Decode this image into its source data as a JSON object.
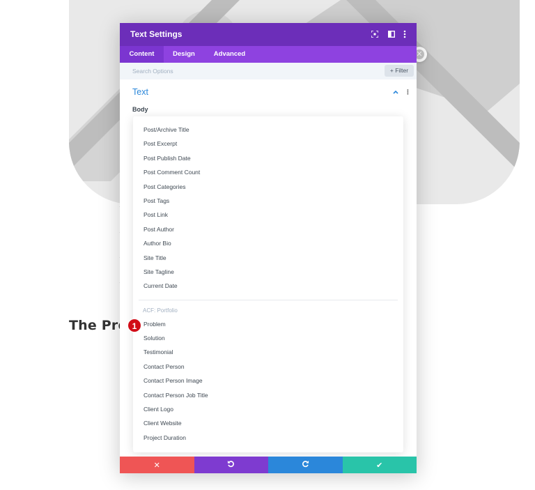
{
  "modal": {
    "title": "Text Settings",
    "tabs": [
      "Content",
      "Design",
      "Advanced"
    ],
    "active_tab": "Content",
    "search_placeholder": "Search Options",
    "filter_label": "+ Filter",
    "section_title": "Text",
    "field_label": "Body"
  },
  "dropdown": {
    "post_items": [
      "Post/Archive Title",
      "Post Excerpt",
      "Post Publish Date",
      "Post Comment Count",
      "Post Categories",
      "Post Tags",
      "Post Link",
      "Post Author",
      "Author Bio",
      "Site Title",
      "Site Tagline",
      "Current Date"
    ],
    "group_label": "ACF: Portfolio",
    "acf_items": [
      "Problem",
      "Solution",
      "Testimonial",
      "Contact Person",
      "Contact Person Image",
      "Contact Person Job Title",
      "Client Logo",
      "Client Website",
      "Project Duration"
    ]
  },
  "background": {
    "heading": "The Pro"
  },
  "annotation": {
    "marker": "1"
  },
  "footer": {
    "icons": [
      "close-icon",
      "undo-icon",
      "redo-icon",
      "check-icon"
    ],
    "colors": [
      "#ef5555",
      "#7e3bd0",
      "#2b87da",
      "#29c4a9"
    ]
  },
  "colors": {
    "titlebar": "#6c2eb9",
    "tabs": "#8e42e0",
    "accent": "#2b87da",
    "marker": "#d10c17"
  }
}
